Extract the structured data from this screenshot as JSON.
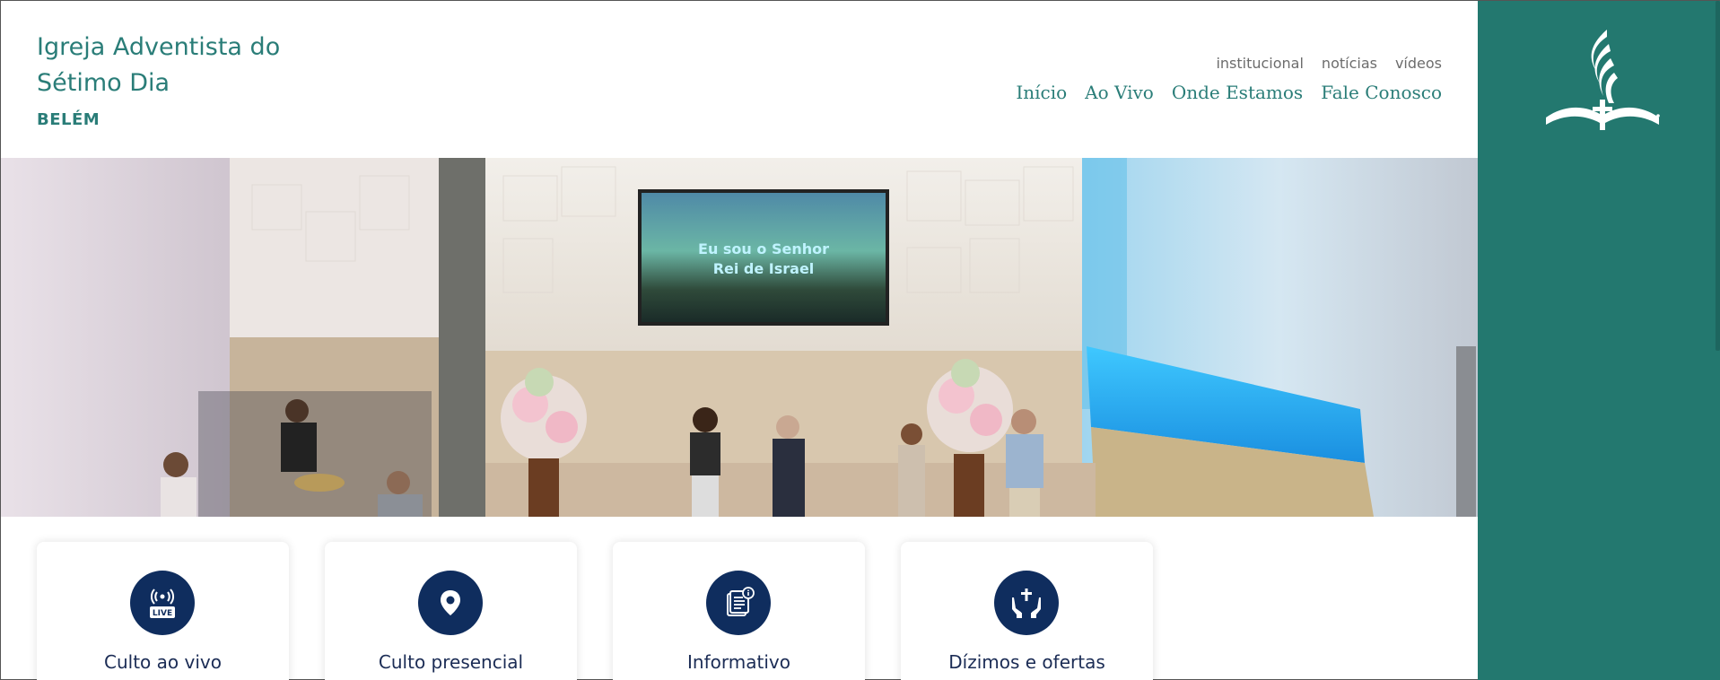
{
  "brand": {
    "title_line1": "Igreja Adventista do",
    "title_line2": "Sétimo Dia",
    "city": "BELÉM"
  },
  "util_nav": [
    "institucional",
    "notícias",
    "vídeos"
  ],
  "main_nav": [
    "Início",
    "Ao Vivo",
    "Onde Estamos",
    "Fale Conosco"
  ],
  "hero": {
    "screen_text_line1": "Eu sou o Senhor",
    "screen_text_line2": "Rei de Israel"
  },
  "cards": [
    {
      "label": "Culto ao vivo",
      "icon": "live-broadcast-icon",
      "icon_text": "LIVE"
    },
    {
      "label": "Culto presencial",
      "icon": "location-pin-icon"
    },
    {
      "label": "Informativo",
      "icon": "document-info-icon"
    },
    {
      "label": "Dízimos e ofertas",
      "icon": "offering-hands-cross-icon"
    }
  ],
  "colors": {
    "teal": "#2a7d78",
    "panel_teal": "#23786f",
    "navy": "#0f2d5e"
  }
}
